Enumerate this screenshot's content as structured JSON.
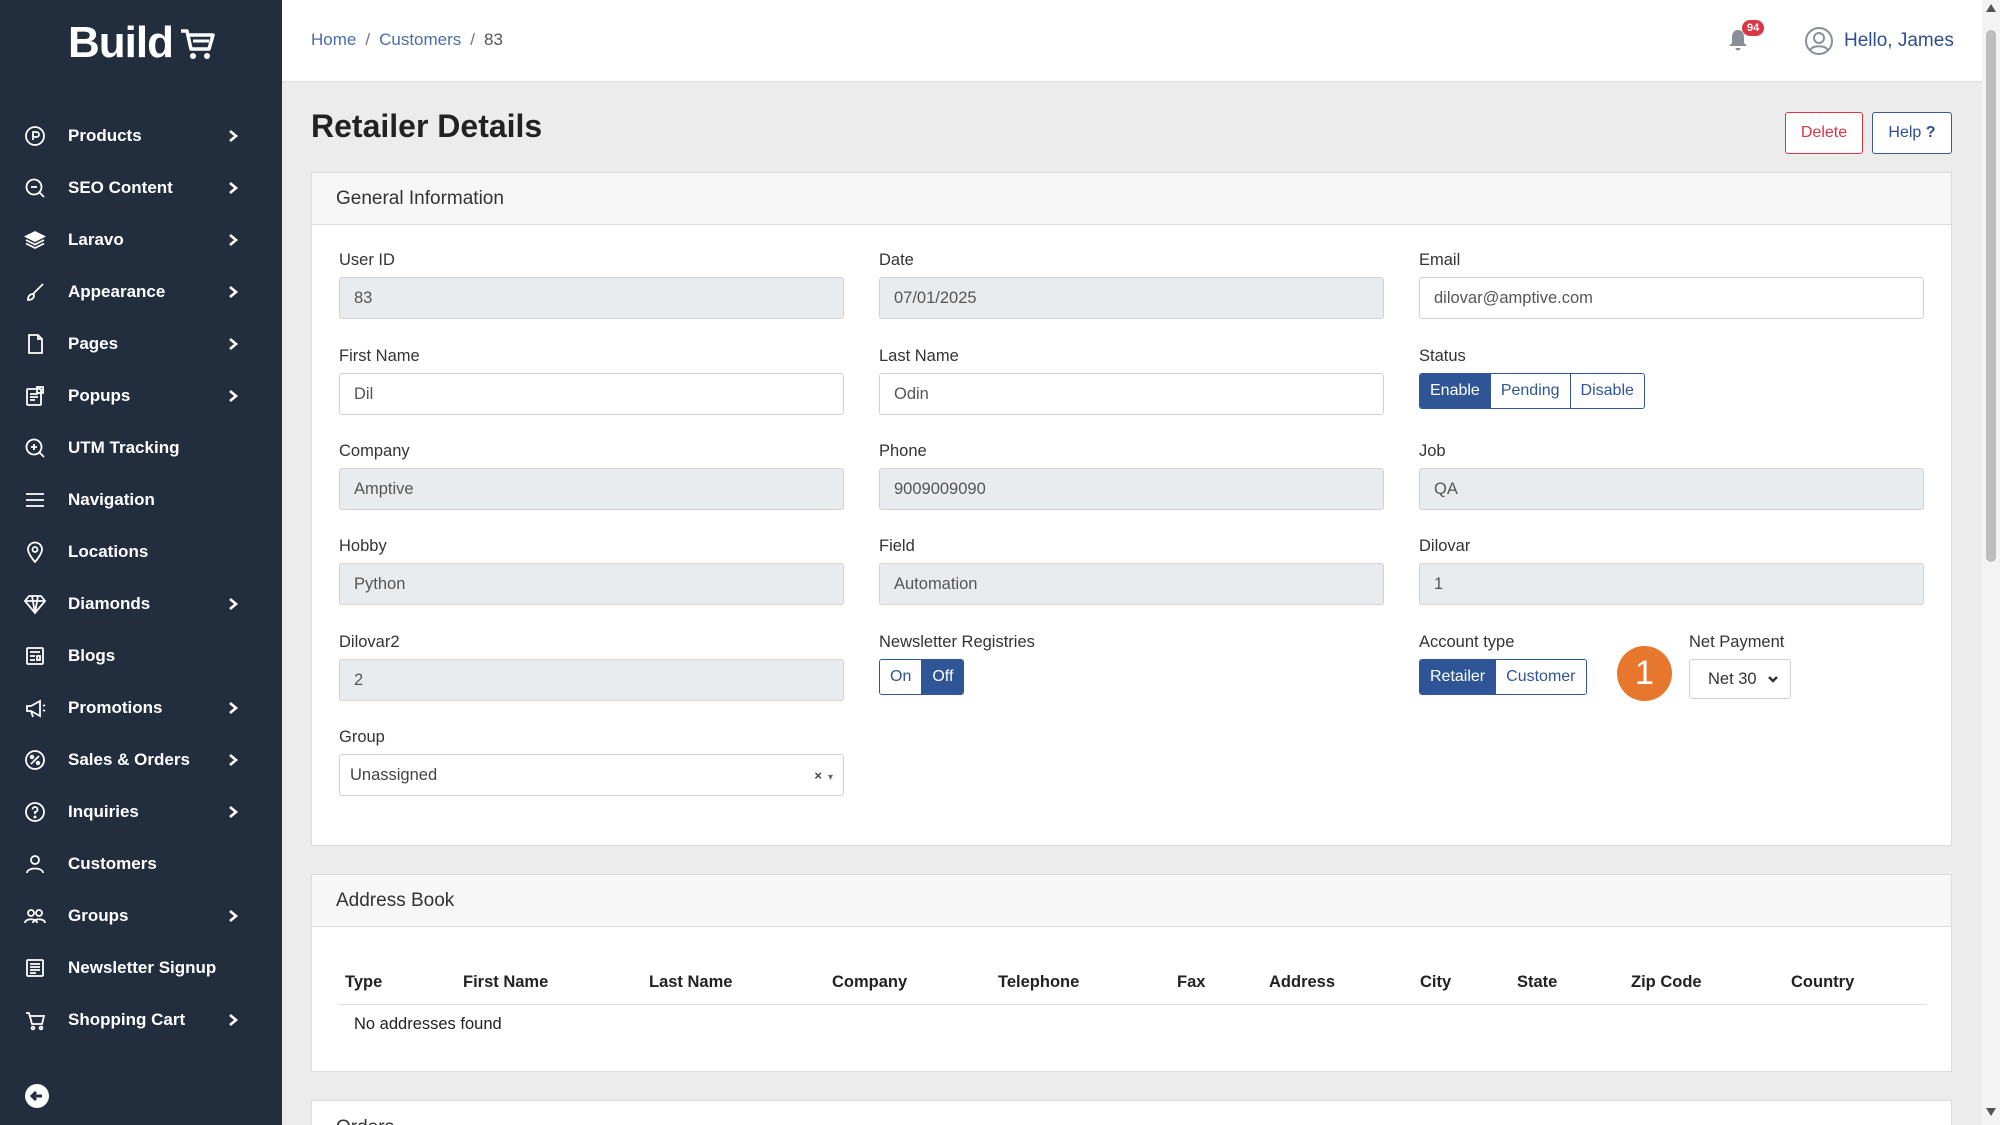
{
  "brand": {
    "name": "Build"
  },
  "sidebar": {
    "items": [
      {
        "label": "Products",
        "icon": "products-icon",
        "chevron": true
      },
      {
        "label": "SEO Content",
        "icon": "seo-icon",
        "chevron": true
      },
      {
        "label": "Laravo",
        "icon": "layers-icon",
        "chevron": true
      },
      {
        "label": "Appearance",
        "icon": "brush-icon",
        "chevron": true
      },
      {
        "label": "Pages",
        "icon": "page-icon",
        "chevron": true
      },
      {
        "label": "Popups",
        "icon": "popup-icon",
        "chevron": true
      },
      {
        "label": "UTM Tracking",
        "icon": "utm-icon",
        "chevron": false
      },
      {
        "label": "Navigation",
        "icon": "menu-icon",
        "chevron": false
      },
      {
        "label": "Locations",
        "icon": "location-pin-icon",
        "chevron": false
      },
      {
        "label": "Diamonds",
        "icon": "diamond-icon",
        "chevron": true
      },
      {
        "label": "Blogs",
        "icon": "newspaper-icon",
        "chevron": false
      },
      {
        "label": "Promotions",
        "icon": "megaphone-icon",
        "chevron": true
      },
      {
        "label": "Sales & Orders",
        "icon": "percent-icon",
        "chevron": true
      },
      {
        "label": "Inquiries",
        "icon": "question-icon",
        "chevron": true
      },
      {
        "label": "Customers",
        "icon": "user-icon",
        "chevron": false
      },
      {
        "label": "Groups",
        "icon": "users-icon",
        "chevron": true
      },
      {
        "label": "Newsletter Signup",
        "icon": "newsletter-icon",
        "chevron": false
      },
      {
        "label": "Shopping Cart",
        "icon": "cart-icon",
        "chevron": true
      }
    ]
  },
  "breadcrumb": {
    "home": "Home",
    "sep": "/",
    "customers": "Customers",
    "current": "83"
  },
  "header": {
    "notifications": "94",
    "greeting": "Hello, James"
  },
  "page": {
    "title": "Retailer Details",
    "delete_label": "Delete",
    "help_label": "Help",
    "help_mark": "?"
  },
  "general": {
    "title": "General Information",
    "user_id": {
      "label": "User ID",
      "value": "83"
    },
    "date": {
      "label": "Date",
      "value": "07/01/2025"
    },
    "email": {
      "label": "Email",
      "value": "dilovar@amptive.com"
    },
    "first_name": {
      "label": "First Name",
      "value": "Dil"
    },
    "last_name": {
      "label": "Last Name",
      "value": "Odin"
    },
    "status": {
      "label": "Status",
      "options": [
        "Enable",
        "Pending",
        "Disable"
      ],
      "selected": "Enable"
    },
    "company": {
      "label": "Company",
      "value": "Amptive"
    },
    "phone": {
      "label": "Phone",
      "value": "9009009090"
    },
    "job": {
      "label": "Job",
      "value": "QA"
    },
    "hobby": {
      "label": "Hobby",
      "value": "Python"
    },
    "field": {
      "label": "Field",
      "value": "Automation"
    },
    "dilovar": {
      "label": "Dilovar",
      "value": "1"
    },
    "dilovar2": {
      "label": "Dilovar2",
      "value": "2"
    },
    "newsletter": {
      "label": "Newsletter Registries",
      "options": [
        "On",
        "Off"
      ],
      "selected": "Off"
    },
    "account_type": {
      "label": "Account type",
      "options": [
        "Retailer",
        "Customer"
      ],
      "selected": "Retailer"
    },
    "step_marker": "1",
    "net_payment": {
      "label": "Net Payment",
      "value": "Net 30"
    },
    "group": {
      "label": "Group",
      "value": "Unassigned",
      "clear": "×",
      "caret": "▾"
    }
  },
  "address_book": {
    "title": "Address Book",
    "columns": [
      "Type",
      "First Name",
      "Last Name",
      "Company",
      "Telephone",
      "Fax",
      "Address",
      "City",
      "State",
      "Zip Code",
      "Country"
    ],
    "empty_text": "No addresses found"
  },
  "orders": {
    "title": "Orders"
  },
  "colors": {
    "sidebar_bg": "#222d3d",
    "primary": "#2f5597",
    "danger": "#dc3545",
    "step_badge": "#e8772e"
  }
}
